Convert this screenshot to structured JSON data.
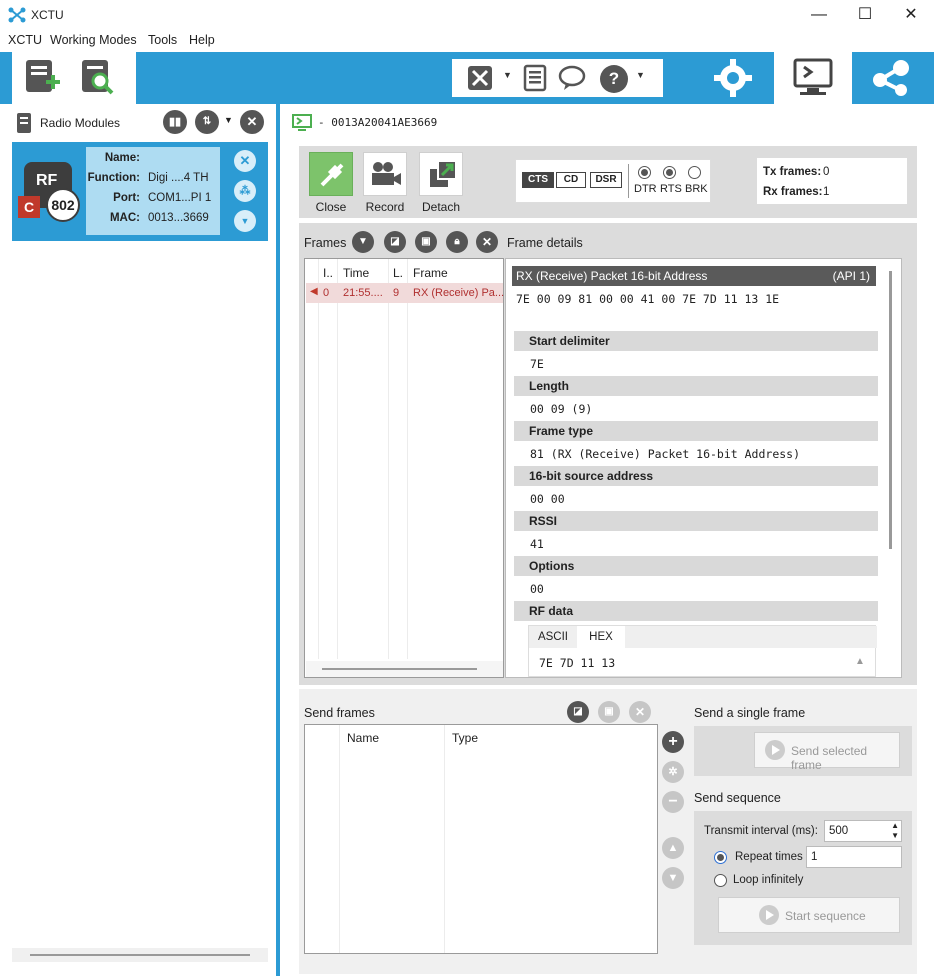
{
  "window": {
    "title": "XCTU",
    "minimize": "—",
    "maximize": "☐",
    "close": "✕"
  },
  "menu": [
    "XCTU",
    "Working Modes",
    "Tools",
    "Help"
  ],
  "left_panel": {
    "title": "Radio Modules",
    "module": {
      "badge_top": "RF",
      "badge_num": "802",
      "badge_c": "C",
      "fields": [
        {
          "label": "Name:",
          "value": ""
        },
        {
          "label": "Function:",
          "value": "Digi ....4 TH"
        },
        {
          "label": "Port:",
          "value": "COM1...PI 1"
        },
        {
          "label": "MAC:",
          "value": "0013...3669"
        }
      ]
    }
  },
  "console": {
    "address": "- 0013A20041AE3669",
    "buttons": {
      "close": "Close",
      "record": "Record",
      "detach": "Detach"
    },
    "signals": [
      "CTS",
      "CD",
      "DSR"
    ],
    "lines": [
      {
        "label": "DTR",
        "on": true
      },
      {
        "label": "RTS",
        "on": true
      },
      {
        "label": "BRK",
        "on": false
      }
    ],
    "counters": {
      "tx_label": "Tx frames:",
      "tx": "0",
      "rx_label": "Rx frames:",
      "rx": "1"
    }
  },
  "frames": {
    "title": "Frames",
    "columns": [
      "I..",
      "Time",
      "L.",
      "Frame"
    ],
    "rows": [
      {
        "index": "0",
        "time": "21:55....",
        "length": "9",
        "frame": "RX (Receive) Pa..."
      }
    ]
  },
  "details": {
    "title": "Frame details",
    "frame_name": "RX (Receive) Packet 16-bit Address",
    "api": "(API 1)",
    "raw": "7E 00 09 81 00 00 41 00 7E 7D 11 13 1E",
    "fields": [
      {
        "name": "Start delimiter",
        "value": "7E"
      },
      {
        "name": "Length",
        "value": "00 09 (9)"
      },
      {
        "name": "Frame type",
        "value": "81 (RX (Receive) Packet 16-bit Address)"
      },
      {
        "name": "16-bit source address",
        "value": "00 00"
      },
      {
        "name": "RSSI",
        "value": "41"
      },
      {
        "name": "Options",
        "value": "00"
      },
      {
        "name": "RF data",
        "value": ""
      }
    ],
    "rf_tabs": [
      "ASCII",
      "HEX"
    ],
    "rf_value": "7E 7D 11 13"
  },
  "send": {
    "title": "Send frames",
    "columns": [
      "Name",
      "Type"
    ],
    "single_title": "Send a single frame",
    "single_button": "Send selected frame",
    "sequence_title": "Send sequence",
    "interval_label": "Transmit interval (ms):",
    "interval_value": "500",
    "repeat_label": "Repeat times",
    "repeat_value": "1",
    "loop_label": "Loop infinitely",
    "start_button": "Start sequence"
  },
  "colors": {
    "accent": "#2c9bd4",
    "selected_row": "#f1dada",
    "frame_header": "#5a5a5a"
  }
}
